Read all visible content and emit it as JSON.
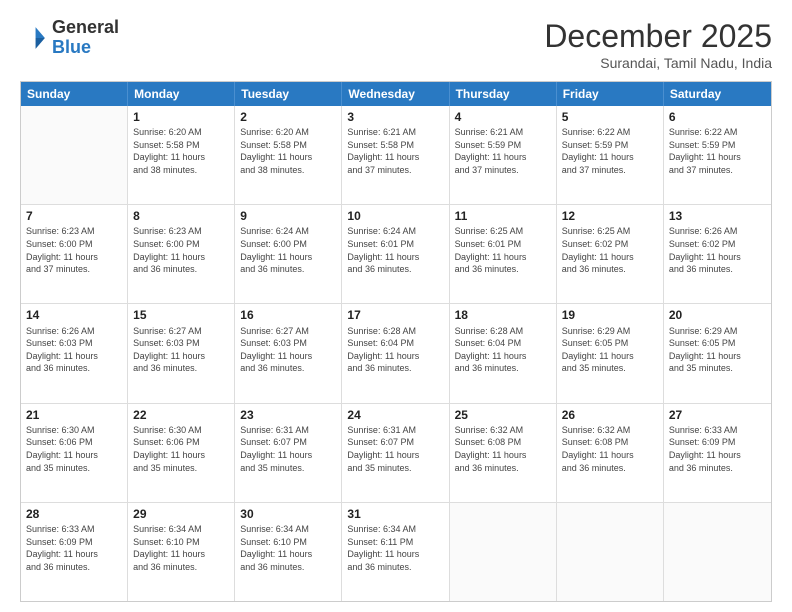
{
  "header": {
    "logo_general": "General",
    "logo_blue": "Blue",
    "month": "December 2025",
    "location": "Surandai, Tamil Nadu, India"
  },
  "days_of_week": [
    "Sunday",
    "Monday",
    "Tuesday",
    "Wednesday",
    "Thursday",
    "Friday",
    "Saturday"
  ],
  "weeks": [
    [
      {
        "day": "",
        "info": ""
      },
      {
        "day": "1",
        "info": "Sunrise: 6:20 AM\nSunset: 5:58 PM\nDaylight: 11 hours\nand 38 minutes."
      },
      {
        "day": "2",
        "info": "Sunrise: 6:20 AM\nSunset: 5:58 PM\nDaylight: 11 hours\nand 38 minutes."
      },
      {
        "day": "3",
        "info": "Sunrise: 6:21 AM\nSunset: 5:58 PM\nDaylight: 11 hours\nand 37 minutes."
      },
      {
        "day": "4",
        "info": "Sunrise: 6:21 AM\nSunset: 5:59 PM\nDaylight: 11 hours\nand 37 minutes."
      },
      {
        "day": "5",
        "info": "Sunrise: 6:22 AM\nSunset: 5:59 PM\nDaylight: 11 hours\nand 37 minutes."
      },
      {
        "day": "6",
        "info": "Sunrise: 6:22 AM\nSunset: 5:59 PM\nDaylight: 11 hours\nand 37 minutes."
      }
    ],
    [
      {
        "day": "7",
        "info": "Sunrise: 6:23 AM\nSunset: 6:00 PM\nDaylight: 11 hours\nand 37 minutes."
      },
      {
        "day": "8",
        "info": "Sunrise: 6:23 AM\nSunset: 6:00 PM\nDaylight: 11 hours\nand 36 minutes."
      },
      {
        "day": "9",
        "info": "Sunrise: 6:24 AM\nSunset: 6:00 PM\nDaylight: 11 hours\nand 36 minutes."
      },
      {
        "day": "10",
        "info": "Sunrise: 6:24 AM\nSunset: 6:01 PM\nDaylight: 11 hours\nand 36 minutes."
      },
      {
        "day": "11",
        "info": "Sunrise: 6:25 AM\nSunset: 6:01 PM\nDaylight: 11 hours\nand 36 minutes."
      },
      {
        "day": "12",
        "info": "Sunrise: 6:25 AM\nSunset: 6:02 PM\nDaylight: 11 hours\nand 36 minutes."
      },
      {
        "day": "13",
        "info": "Sunrise: 6:26 AM\nSunset: 6:02 PM\nDaylight: 11 hours\nand 36 minutes."
      }
    ],
    [
      {
        "day": "14",
        "info": "Sunrise: 6:26 AM\nSunset: 6:03 PM\nDaylight: 11 hours\nand 36 minutes."
      },
      {
        "day": "15",
        "info": "Sunrise: 6:27 AM\nSunset: 6:03 PM\nDaylight: 11 hours\nand 36 minutes."
      },
      {
        "day": "16",
        "info": "Sunrise: 6:27 AM\nSunset: 6:03 PM\nDaylight: 11 hours\nand 36 minutes."
      },
      {
        "day": "17",
        "info": "Sunrise: 6:28 AM\nSunset: 6:04 PM\nDaylight: 11 hours\nand 36 minutes."
      },
      {
        "day": "18",
        "info": "Sunrise: 6:28 AM\nSunset: 6:04 PM\nDaylight: 11 hours\nand 36 minutes."
      },
      {
        "day": "19",
        "info": "Sunrise: 6:29 AM\nSunset: 6:05 PM\nDaylight: 11 hours\nand 35 minutes."
      },
      {
        "day": "20",
        "info": "Sunrise: 6:29 AM\nSunset: 6:05 PM\nDaylight: 11 hours\nand 35 minutes."
      }
    ],
    [
      {
        "day": "21",
        "info": "Sunrise: 6:30 AM\nSunset: 6:06 PM\nDaylight: 11 hours\nand 35 minutes."
      },
      {
        "day": "22",
        "info": "Sunrise: 6:30 AM\nSunset: 6:06 PM\nDaylight: 11 hours\nand 35 minutes."
      },
      {
        "day": "23",
        "info": "Sunrise: 6:31 AM\nSunset: 6:07 PM\nDaylight: 11 hours\nand 35 minutes."
      },
      {
        "day": "24",
        "info": "Sunrise: 6:31 AM\nSunset: 6:07 PM\nDaylight: 11 hours\nand 35 minutes."
      },
      {
        "day": "25",
        "info": "Sunrise: 6:32 AM\nSunset: 6:08 PM\nDaylight: 11 hours\nand 36 minutes."
      },
      {
        "day": "26",
        "info": "Sunrise: 6:32 AM\nSunset: 6:08 PM\nDaylight: 11 hours\nand 36 minutes."
      },
      {
        "day": "27",
        "info": "Sunrise: 6:33 AM\nSunset: 6:09 PM\nDaylight: 11 hours\nand 36 minutes."
      }
    ],
    [
      {
        "day": "28",
        "info": "Sunrise: 6:33 AM\nSunset: 6:09 PM\nDaylight: 11 hours\nand 36 minutes."
      },
      {
        "day": "29",
        "info": "Sunrise: 6:34 AM\nSunset: 6:10 PM\nDaylight: 11 hours\nand 36 minutes."
      },
      {
        "day": "30",
        "info": "Sunrise: 6:34 AM\nSunset: 6:10 PM\nDaylight: 11 hours\nand 36 minutes."
      },
      {
        "day": "31",
        "info": "Sunrise: 6:34 AM\nSunset: 6:11 PM\nDaylight: 11 hours\nand 36 minutes."
      },
      {
        "day": "",
        "info": ""
      },
      {
        "day": "",
        "info": ""
      },
      {
        "day": "",
        "info": ""
      }
    ]
  ]
}
